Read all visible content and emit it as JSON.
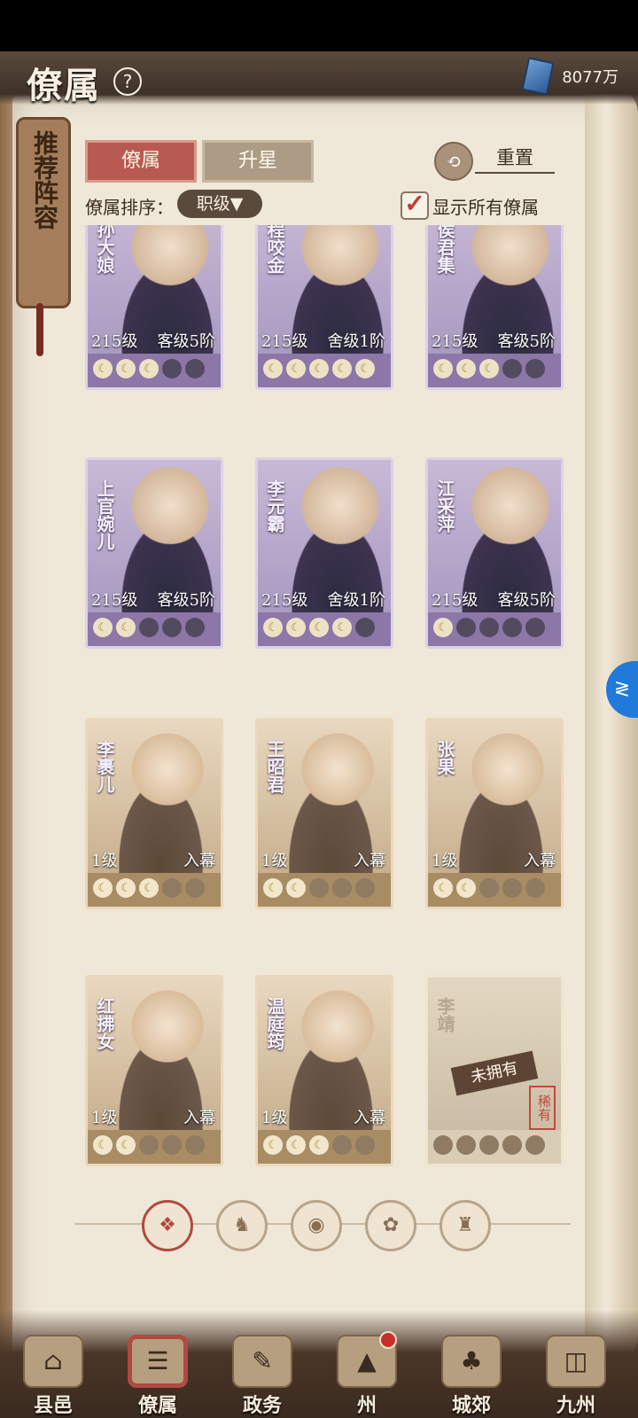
{
  "header": {
    "title": "僚属",
    "help": "?",
    "currency": "8077万"
  },
  "side_scroll": {
    "label": "推荐阵容"
  },
  "tabs": [
    {
      "label": "僚属"
    },
    {
      "label": "升星"
    }
  ],
  "reset": {
    "label": "重置"
  },
  "sort": {
    "label": "僚属排序：",
    "value": "职级▼"
  },
  "show_all": {
    "label": "显示所有僚属",
    "check": "✓"
  },
  "cards": [
    {
      "name": "孙大娘",
      "level": "215级",
      "rank": "客级5阶",
      "pips_on": 3,
      "faction": "",
      "badge": ""
    },
    {
      "name": "程咬金",
      "level": "215级",
      "rank": "舍级1阶",
      "pips_on": 5,
      "faction": "",
      "badge": ""
    },
    {
      "name": "侯君集",
      "level": "215级",
      "rank": "客级5阶",
      "pips_on": 3,
      "faction": "",
      "badge": ""
    },
    {
      "name": "上官婉儿",
      "level": "215级",
      "rank": "客级5阶",
      "pips_on": 2,
      "faction": "",
      "badge": ""
    },
    {
      "name": "李元霸",
      "level": "215级",
      "rank": "舍级1阶",
      "pips_on": 4,
      "faction": "",
      "badge": ""
    },
    {
      "name": "江采萍",
      "level": "215级",
      "rank": "客级5阶",
      "pips_on": 1,
      "faction": "",
      "badge": ""
    },
    {
      "name": "李裹儿",
      "level": "1级",
      "rank": "入幕",
      "pips_on": 3,
      "faction": "",
      "badge": ""
    },
    {
      "name": "王昭君",
      "level": "1级",
      "rank": "入幕",
      "pips_on": 2,
      "faction": "",
      "badge": ""
    },
    {
      "name": "张果",
      "level": "1级",
      "rank": "入幕",
      "pips_on": 2,
      "faction": "",
      "badge": ""
    },
    {
      "name": "红拂女",
      "level": "1级",
      "rank": "入幕",
      "pips_on": 2,
      "faction": "",
      "badge": ""
    },
    {
      "name": "温庭筠",
      "level": "1级",
      "rank": "入幕",
      "pips_on": 3,
      "faction": "",
      "badge": ""
    },
    {
      "name": "李靖",
      "level": "",
      "rank": "",
      "pips_on": 0,
      "faction": "",
      "badge": "",
      "locked": "未拥有",
      "rarity": "稀有"
    }
  ],
  "filters": [
    "❖",
    "♞",
    "◉",
    "✿",
    "♜"
  ],
  "bottom_nav": [
    {
      "label": "县邑",
      "glyph": "⌂"
    },
    {
      "label": "僚属",
      "glyph": "☰"
    },
    {
      "label": "政务",
      "glyph": "✎"
    },
    {
      "label": "州",
      "glyph": "▲"
    },
    {
      "label": "城郊",
      "glyph": "♣"
    },
    {
      "label": "九州",
      "glyph": "◫"
    }
  ],
  "side_button": {
    "glyph": "≷"
  },
  "colors": {
    "accent": "#b85a52",
    "purple_card": "#8c77a8",
    "gold_card": "#a88c64"
  }
}
